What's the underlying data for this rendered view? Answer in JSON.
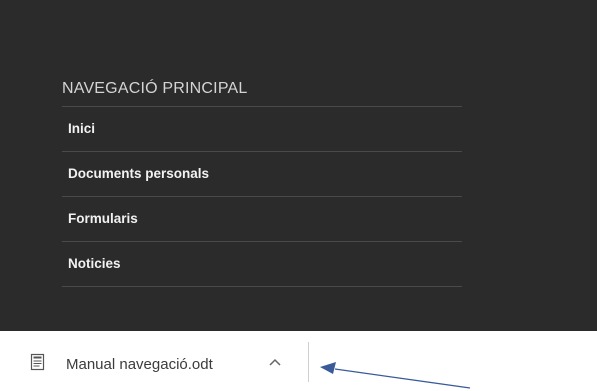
{
  "nav": {
    "heading": "NAVEGACIÓ PRINCIPAL",
    "items": [
      {
        "label": "Inici"
      },
      {
        "label": "Documents personals"
      },
      {
        "label": "Formularis"
      },
      {
        "label": "Noticies"
      }
    ]
  },
  "download": {
    "file_name": "Manual navegació.odt",
    "file_icon": "document-icon",
    "expand_icon": "chevron-up-icon"
  },
  "annotation": {
    "arrow_color": "#3a5a9a"
  }
}
